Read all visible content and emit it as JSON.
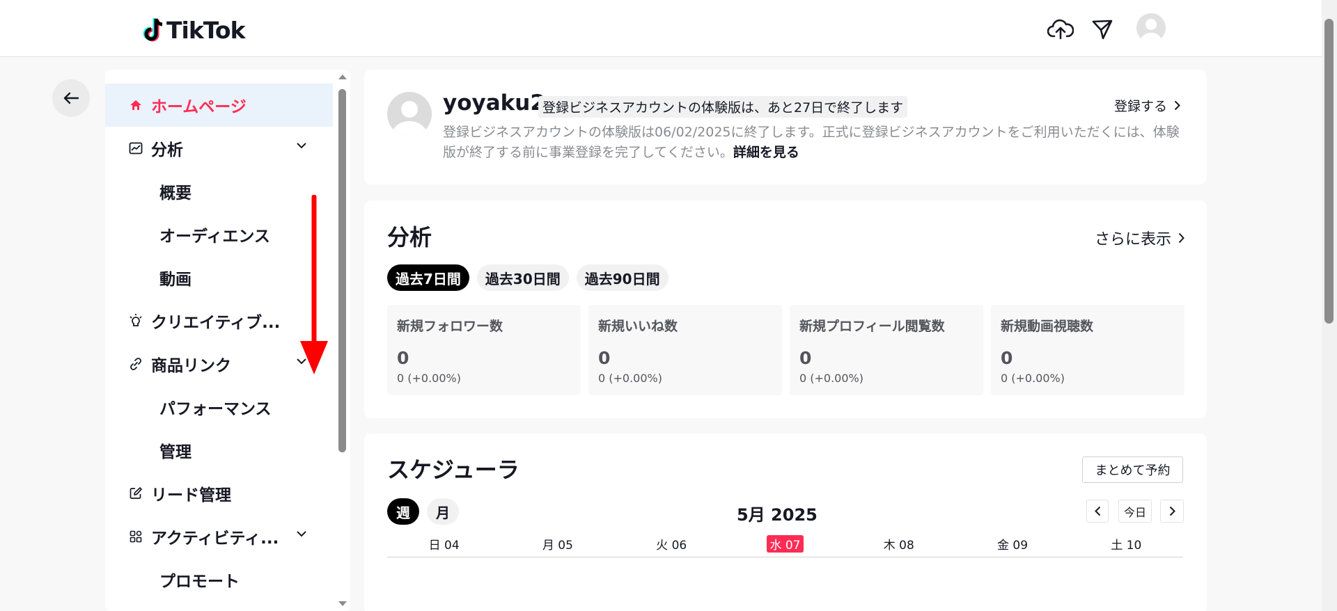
{
  "brand": {
    "name": "TikTok"
  },
  "header": {
    "icons": [
      "upload-cloud-icon",
      "send-icon",
      "avatar"
    ]
  },
  "sidebar": {
    "items": [
      {
        "label": "ホームページ",
        "icon": "home-icon",
        "active": true
      },
      {
        "label": "分析",
        "icon": "analytics-icon",
        "expand": true
      },
      {
        "label": "概要",
        "sub": true
      },
      {
        "label": "オーディエンス",
        "sub": true
      },
      {
        "label": "動画",
        "sub": true
      },
      {
        "label": "クリエイティブ...",
        "icon": "bulb-icon"
      },
      {
        "label": "商品リンク",
        "icon": "link-icon",
        "expand": true
      },
      {
        "label": "パフォーマンス",
        "sub": true
      },
      {
        "label": "管理",
        "sub": true
      },
      {
        "label": "リード管理",
        "icon": "edit-icon"
      },
      {
        "label": "アクティビティ...",
        "icon": "apps-icon",
        "expand": true
      },
      {
        "label": "プロモート",
        "sub": true
      }
    ]
  },
  "account": {
    "username": "yoyaku2",
    "trial_badge": "登録ビジネスアカウントの体験版は、あと27日で終了します",
    "trial_desc": "登録ビジネスアカウントの体験版は06/02/2025に終了します。正式に登録ビジネスアカウントをご利用いただくには、体験版が終了する前に事業登録を完了してください。",
    "details_link": "詳細を見る",
    "register_label": "登録する"
  },
  "analytics": {
    "title": "分析",
    "more_label": "さらに表示",
    "ranges": [
      "過去7日間",
      "過去30日間",
      "過去90日間"
    ],
    "active_range": 0,
    "metrics": [
      {
        "label": "新規フォロワー数",
        "value": "0",
        "change": "0 (+0.00%)"
      },
      {
        "label": "新規いいね数",
        "value": "0",
        "change": "0 (+0.00%)"
      },
      {
        "label": "新規プロフィール閲覧数",
        "value": "0",
        "change": "0 (+0.00%)"
      },
      {
        "label": "新規動画視聴数",
        "value": "0",
        "change": "0 (+0.00%)"
      }
    ]
  },
  "scheduler": {
    "title": "スケジューラ",
    "batch_label": "まとめて予約",
    "views": [
      "週",
      "月"
    ],
    "active_view": 0,
    "month_label": "5月 2025",
    "today_label": "今日",
    "days": [
      "日 04",
      "月 05",
      "火 06",
      "水 07",
      "木 08",
      "金 09",
      "土 10"
    ],
    "today_index": 3
  },
  "colors": {
    "accent": "#fe2c55",
    "annotation": "#ff0000",
    "active_bg": "#eaf2fb"
  }
}
